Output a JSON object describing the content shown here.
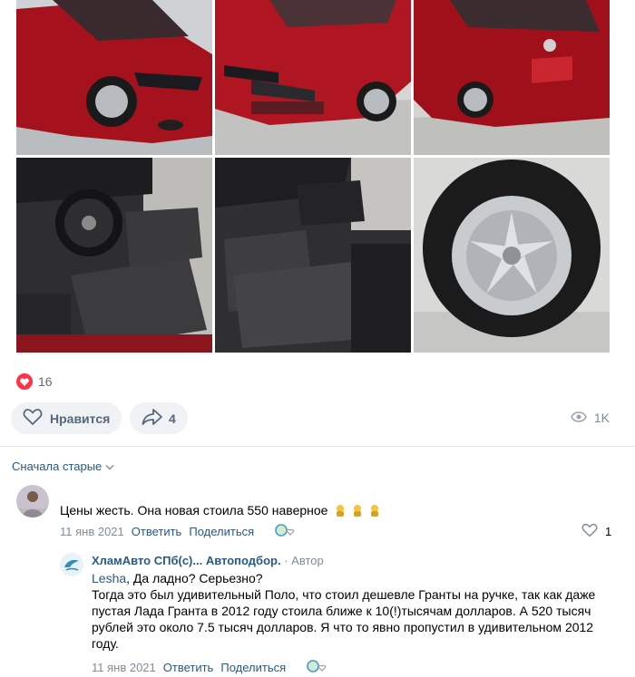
{
  "post": {
    "likes_count": "16",
    "like_button_label": "Нравится",
    "share_count": "4",
    "views": "1K"
  },
  "comments": {
    "sort_label": "Сначала старые",
    "items": [
      {
        "text": "Цены жесть. Она новая стоила 550 наверное",
        "date": "11 янв 2021",
        "reply_label": "Ответить",
        "share_label": "Поделиться",
        "likes": "1"
      }
    ],
    "reply": {
      "author": "ХламАвто СПб(с)... Автоподбор.",
      "role": "· Автор",
      "mention": "Lesha",
      "text_first_line": ", Да ладно? Серьезно?",
      "text_line_2": "Тогда это был удивительный Поло, что стоил дешевле Гранты на ручке, так как даже",
      "text_line_3": "пустая Лада Гранта в 2012 году стоила ближе к 10(!)тысячам долларов. А 520 тысяч",
      "text_line_4": "рублей это около 7.5 тысяч долларов. Я что то явно пропустил в удивительном 2012",
      "text_line_5": "году.",
      "date": "11 янв 2021",
      "reply_label": "Ответить",
      "share_label": "Поделиться"
    }
  },
  "colors": {
    "link": "#2a5885",
    "heart": "#ff3347",
    "button_bg": "#f0f2f5",
    "muted": "#818c99"
  }
}
